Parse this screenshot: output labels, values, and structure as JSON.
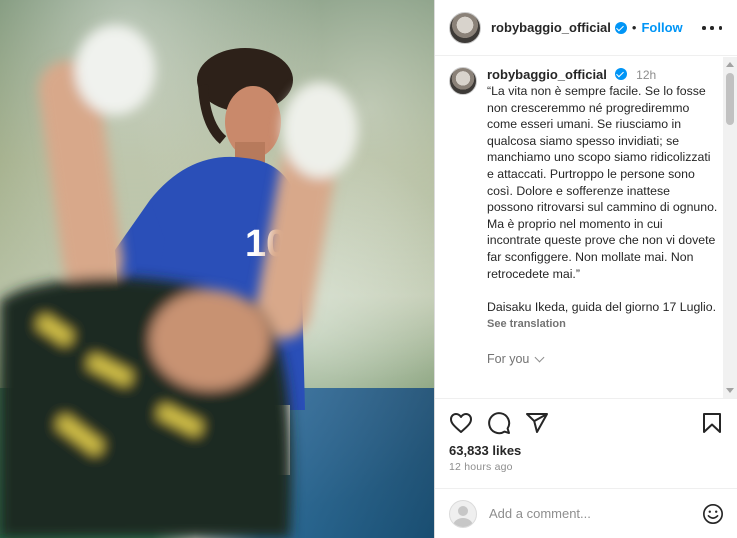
{
  "post": {
    "username": "robybaggio_official",
    "follow_label": "Follow",
    "separator": "•"
  },
  "caption": {
    "username": "robybaggio_official",
    "time": "12h",
    "text": "“La vita non è sempre facile. Se lo fosse non cresceremmo né progrediremmo come esseri umani. Se riusciamo in qualcosa siamo spesso invidiati; se manchiamo uno scopo siamo ridicolizzati e attaccati. Purtroppo le persone sono così. Dolore e sofferenze inattese possono ritrovarsi sul cammino di ognuno. Ma è proprio nel momento in cui incontrate queste prove che non vi dovete far sconfiggere. Non mollate mai. Non retrocedete mai.”\n\nDaisaku Ikeda, guida del giorno 17 Luglio.",
    "see_translation": "See translation"
  },
  "for_you": "For you",
  "stats": {
    "likes": "63,833 likes",
    "ago": "12 hours ago"
  },
  "comment": {
    "placeholder": "Add a comment..."
  },
  "icons": {
    "like": "heart-icon",
    "comment": "comment-icon",
    "share": "share-icon",
    "save": "bookmark-icon",
    "emoji": "emoji-icon"
  },
  "colors": {
    "accent": "#0095f6",
    "text": "#262626",
    "muted": "#8e8e8e",
    "jersey": "#2a4fb8"
  }
}
